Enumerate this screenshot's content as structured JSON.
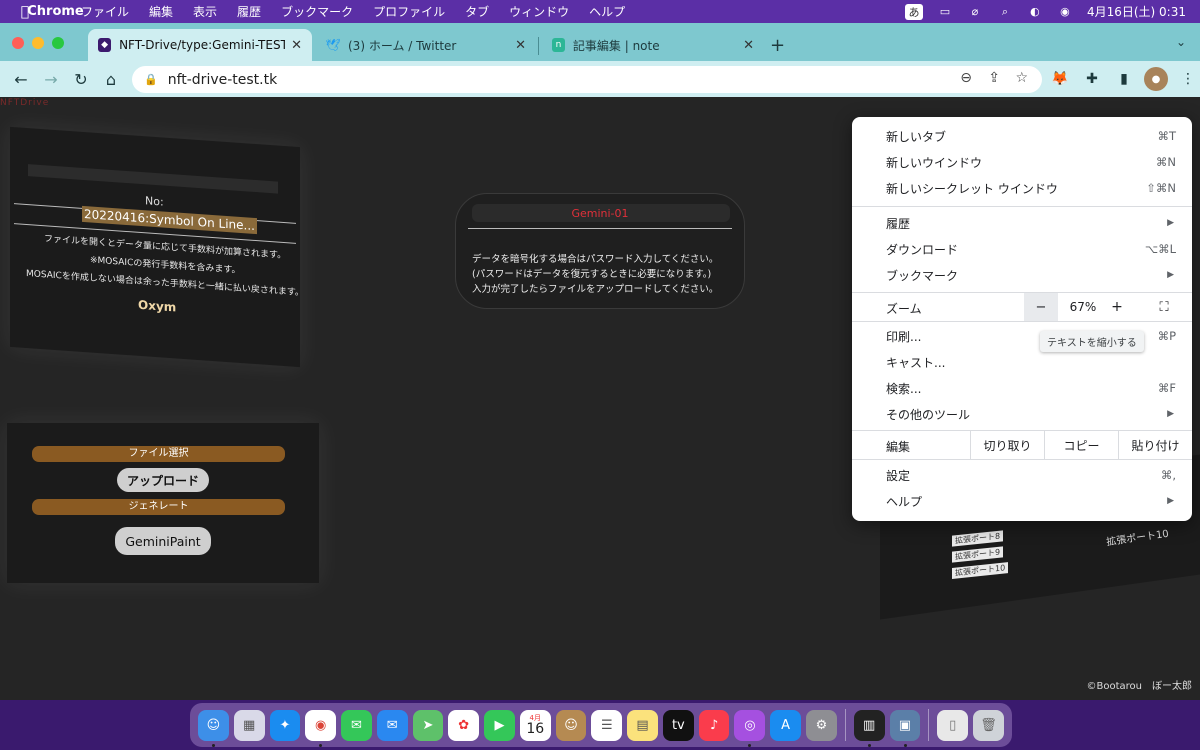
{
  "menubar": {
    "app_name": "Chrome",
    "items": [
      "ファイル",
      "編集",
      "表示",
      "履歴",
      "ブックマーク",
      "プロファイル",
      "タブ",
      "ウィンドウ",
      "ヘルプ"
    ],
    "ime": "あ",
    "datetime": "4月16日(土)  0:31"
  },
  "tabs": [
    {
      "title": "NFT-Drive/type:Gemini-TEST_",
      "favicon": "shield-icon",
      "active": true
    },
    {
      "title": "(3) ホーム / Twitter",
      "favicon": "twitter-icon",
      "active": false
    },
    {
      "title": "記事編集 | note",
      "favicon": "note-icon",
      "active": false
    }
  ],
  "toolbar": {
    "url": "nft-drive-test.tk"
  },
  "page": {
    "brand": "NFTDrive",
    "panel1": {
      "no_label": "No:",
      "date_text": "20220416:Symbol On Line...",
      "line1": "ファイルを開くとデータ量に応じて手数料が加算されます。",
      "line2": "※MOSAICの発行手数料を含みます。",
      "line3": "MOSAICを作成しない場合は余った手数料と一緒に払い戻されます。",
      "logo": "Oxym"
    },
    "panel2": {
      "file_select": "ファイル選択",
      "upload": "アップロード",
      "generate": "ジェネレート",
      "gemini_paint": "GeminiPaint"
    },
    "panel3": {
      "title": "Gemini-01",
      "line1": "データを暗号化する場合はパスワード入力してください。",
      "line2": "(パスワードはデータを復元するときに必要になります。)",
      "line3": "入力が完了したらファイルをアップロードしてください。"
    },
    "ports": [
      "拡張ポート8",
      "拡張ポート9",
      "拡張ポート10"
    ],
    "port_right": "拡張ポート10",
    "credit": "©Bootarou　ぼー太郎"
  },
  "chrome_menu": {
    "new_tab": {
      "label": "新しいタブ",
      "shortcut": "⌘T"
    },
    "new_window": {
      "label": "新しいウインドウ",
      "shortcut": "⌘N"
    },
    "new_incognito": {
      "label": "新しいシークレット ウインドウ",
      "shortcut": "⇧⌘N"
    },
    "history": {
      "label": "履歴"
    },
    "downloads": {
      "label": "ダウンロード",
      "shortcut": "⌥⌘L"
    },
    "bookmarks": {
      "label": "ブックマーク"
    },
    "zoom": {
      "label": "ズーム",
      "minus": "−",
      "value": "67%",
      "plus": "+"
    },
    "zoom_tooltip": "テキストを縮小する",
    "print": {
      "label": "印刷...",
      "shortcut": "⌘P"
    },
    "cast": {
      "label": "キャスト..."
    },
    "find": {
      "label": "検索...",
      "shortcut": "⌘F"
    },
    "more_tools": {
      "label": "その他のツール"
    },
    "edit": {
      "label": "編集",
      "cut": "切り取り",
      "copy": "コピー",
      "paste": "貼り付け"
    },
    "settings": {
      "label": "設定",
      "shortcut": "⌘,"
    },
    "help": {
      "label": "ヘルプ"
    }
  },
  "dock": {
    "calendar_month": "4月",
    "calendar_day": "16"
  }
}
